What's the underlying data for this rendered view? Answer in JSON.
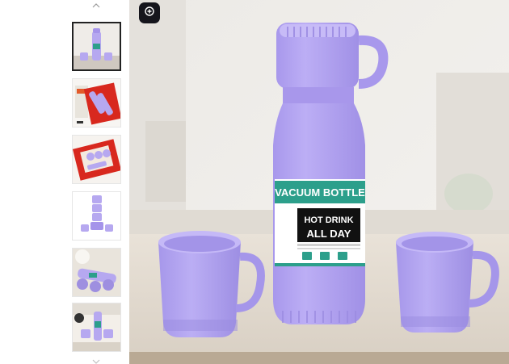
{
  "rail": {
    "thumbnails": [
      {
        "name": "thumb-1",
        "active": true
      },
      {
        "name": "thumb-2",
        "active": false
      },
      {
        "name": "thumb-3",
        "active": false
      },
      {
        "name": "thumb-4",
        "active": false
      },
      {
        "name": "thumb-5",
        "active": false
      },
      {
        "name": "thumb-6",
        "active": false
      }
    ],
    "up_icon": "chevron-up-icon",
    "down_icon": "chevron-down-icon"
  },
  "main": {
    "zoom_icon": "zoom-icon",
    "label": {
      "title": "VACUUM BOTTLE",
      "line1": "HOT DRINK",
      "line2": "ALL DAY"
    },
    "colors": {
      "bottle": "#b6a8f0",
      "bottle_shadow": "#9e8fe0",
      "label_teal": "#2c9f8b",
      "label_black": "#111111"
    }
  }
}
